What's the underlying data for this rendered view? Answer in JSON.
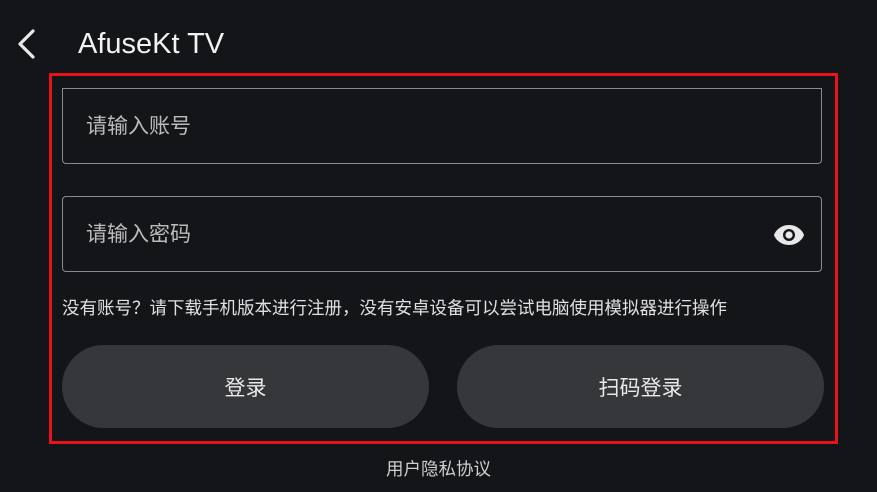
{
  "header": {
    "back_icon": "chevron-left-icon",
    "title": "AfuseKt TV"
  },
  "form": {
    "frame_color": "#e8121b",
    "account": {
      "placeholder": "请输入账号",
      "value": ""
    },
    "password": {
      "placeholder": "请输入密码",
      "value": "",
      "toggle_icon": "eye-icon"
    },
    "hint": "没有账号？请下载手机版本进行注册，没有安卓设备可以尝试电脑使用模拟器进行操作",
    "login_label": "登录",
    "qr_login_label": "扫码登录"
  },
  "footer": {
    "privacy_label": "用户隐私协议"
  },
  "colors": {
    "background": "#141519",
    "button": "#36373a",
    "field_border": "#8a8b8f"
  }
}
